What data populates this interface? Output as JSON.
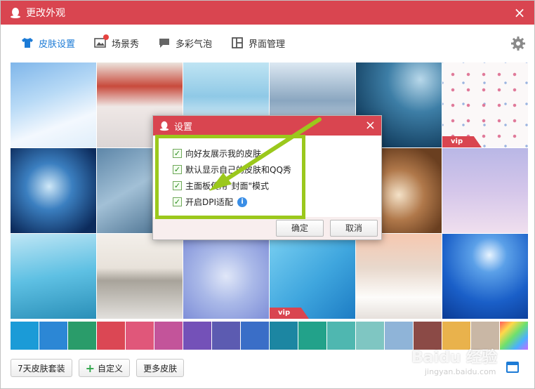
{
  "window": {
    "title": "更改外观",
    "close": "×"
  },
  "tabs": [
    {
      "label": "皮肤设置",
      "icon": "shirt-icon",
      "active": true
    },
    {
      "label": "场景秀",
      "icon": "picture-icon",
      "active": false
    },
    {
      "label": "多彩气泡",
      "icon": "chat-bubble-icon",
      "active": false
    },
    {
      "label": "界面管理",
      "icon": "layout-icon",
      "active": false
    }
  ],
  "skins": [
    {
      "name": "sky-rainbow",
      "bg": "linear-gradient(160deg,#7fb6ea 0%,#b8daf6 40%,#f3f8fe 70%,#dfeefa 100%)",
      "vip": false
    },
    {
      "name": "snowy-street",
      "bg": "linear-gradient(180deg,#ece4dd 0%,#c84a3c 28%,#efe8e6 52%,#dcd6d6 100%)",
      "vip": false
    },
    {
      "name": "snow-trees-snowman",
      "bg": "linear-gradient(180deg,#bfe4f3 0%,#8fc9e6 40%,#f1f9fd 80%,#ffffff 100%)",
      "vip": false
    },
    {
      "name": "snowy-forest",
      "bg": "linear-gradient(180deg,#dce8f2 0%,#8aa6c0 45%,#eef3f8 100%)",
      "vip": false
    },
    {
      "name": "night-lamp-snow",
      "bg": "radial-gradient(circle at 75% 20%,#b8d8ea 0%,#3d7ea6 35%,#123d5e 80%)",
      "vip": false
    },
    {
      "name": "pink-dots",
      "bg": "#fbf8f8",
      "vip": true
    },
    {
      "name": "snowflake-blue",
      "bg": "radial-gradient(circle at 45% 45%,#cfe8f8 0%,#3b7fc0 35%,#0c2b5c 85%)",
      "vip": false
    },
    {
      "name": "merry-christmas",
      "bg": "linear-gradient(150deg,#5d86a8 0%,#a2c0d6 45%,#3b6384 100%)",
      "vip": false
    },
    {
      "name": "covered-1",
      "bg": "#6f8fa8",
      "vip": false
    },
    {
      "name": "covered-2",
      "bg": "#c7b7a8",
      "vip": false
    },
    {
      "name": "latte-snowflake",
      "bg": "radial-gradient(circle at 50% 55%,#f4e2c8 0%,#b0784a 40%,#6a3f20 80%)",
      "vip": false
    },
    {
      "name": "purple-trees",
      "bg": "linear-gradient(180deg,#b9b7e6 0%,#d4c6ea 50%,#f0dfee 100%)",
      "vip": false
    },
    {
      "name": "blue-branches",
      "bg": "linear-gradient(170deg,#bfe6f5 0%,#5ec0e3 50%,#2a8fb8 100%)",
      "vip": false
    },
    {
      "name": "winter-lake",
      "bg": "linear-gradient(180deg,#f3efea 0%,#e8e2da 40%,#a8a39a 55%,#e2e0dc 100%)",
      "vip": false
    },
    {
      "name": "bird-berries",
      "bg": "radial-gradient(circle at 50% 50%,#e0e7f8 0%,#aab9e8 45%,#7e8ed8 100%)",
      "vip": false
    },
    {
      "name": "white-feather",
      "bg": "linear-gradient(135deg,#7ad0f2 0%,#3fa6de 55%,#1d7cc4 100%)",
      "vip": true
    },
    {
      "name": "snow-bridge",
      "bg": "linear-gradient(180deg,#f6c8b0 0%,#e8d8cc 40%,#fdfcfa 75%,#e6e0dc 100%)",
      "vip": false
    },
    {
      "name": "moon-sleigh",
      "bg": "radial-gradient(circle at 55% 25%,#e8f4ff 0%,#5ba0e8 22%,#1a5fc8 60%,#0a3a94 100%)",
      "vip": false
    }
  ],
  "swatches": [
    {
      "name": "sky-blue",
      "color": "#1b9bd7"
    },
    {
      "name": "blue",
      "color": "#2c87d5"
    },
    {
      "name": "green",
      "color": "#2a9c6a"
    },
    {
      "name": "red",
      "color": "#db4754"
    },
    {
      "name": "rose",
      "color": "#e0577a"
    },
    {
      "name": "magenta",
      "color": "#c3549a"
    },
    {
      "name": "violet",
      "color": "#7451b8"
    },
    {
      "name": "indigo",
      "color": "#5c5bb1"
    },
    {
      "name": "royal-blue",
      "color": "#3a6ec7"
    },
    {
      "name": "teal-blue",
      "color": "#1c86a2"
    },
    {
      "name": "teal",
      "color": "#22a28a"
    },
    {
      "name": "aqua",
      "color": "#4fb7b0"
    },
    {
      "name": "light-teal",
      "color": "#7fc6c2"
    },
    {
      "name": "light-blue",
      "color": "#8fb4d8"
    },
    {
      "name": "maroon",
      "color": "#8b4a46"
    },
    {
      "name": "amber",
      "color": "#e9b24c"
    },
    {
      "name": "tan",
      "color": "#c9b7a5"
    },
    {
      "name": "rainbow",
      "color": "linear-gradient(135deg,#ff5b5b,#ffd84a,#6ee06e,#4ab0ff,#c56bff)"
    }
  ],
  "bottom": {
    "skin_pack": "7天皮肤套装",
    "custom": "自定义",
    "more": "更多皮肤",
    "plus": "+"
  },
  "vip_label": "vip",
  "watermark": {
    "main": "Baidu 经验",
    "sub": "jingyan.baidu.com"
  },
  "dialog": {
    "title": "设置",
    "close": "×",
    "options": [
      {
        "label": "向好友展示我的皮肤",
        "checked": true
      },
      {
        "label": "默认显示自己的皮肤和QQ秀",
        "checked": true
      },
      {
        "label": "主面板使用\"封面\"模式",
        "checked": true
      },
      {
        "label": "开启DPI适配",
        "checked": true,
        "info": "i"
      }
    ],
    "ok": "确定",
    "cancel": "取消"
  },
  "colors": {
    "accent": "#d94550",
    "highlight": "#9bc81c",
    "tab_active": "#1c7bd6"
  }
}
